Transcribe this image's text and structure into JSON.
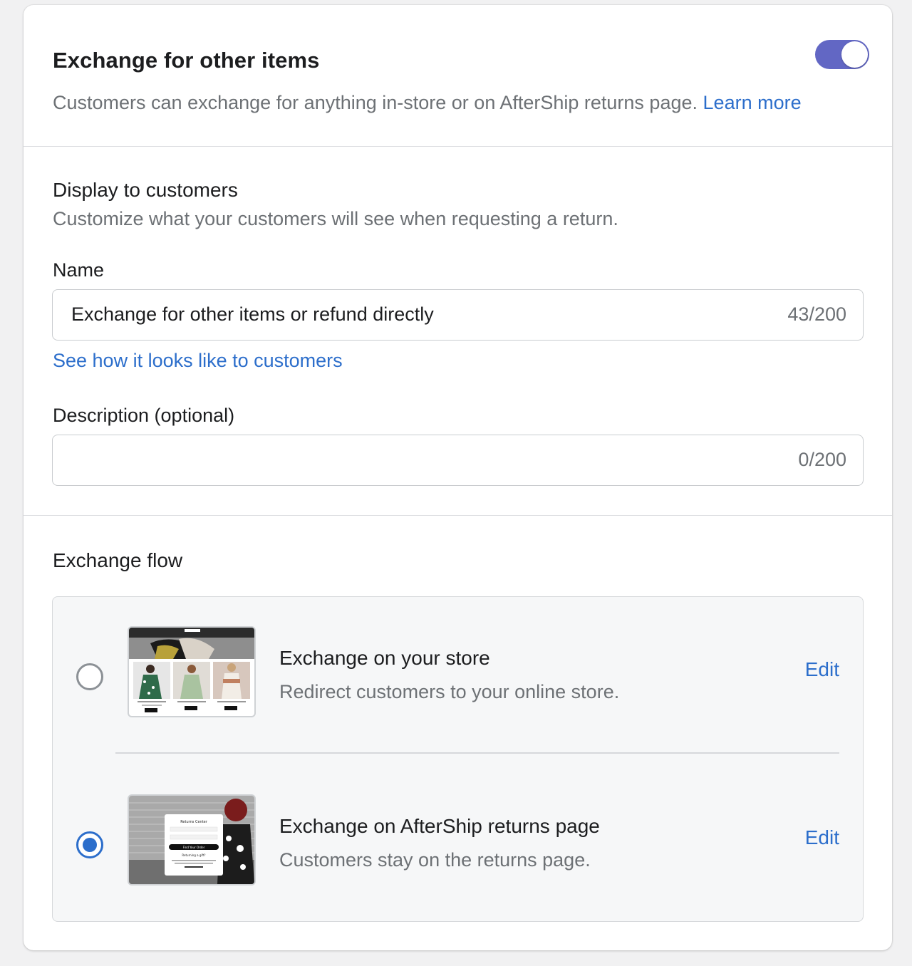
{
  "header": {
    "title": "Exchange for other items",
    "description": "Customers can exchange for anything in-store or on AfterShip returns page.",
    "learn_more": "Learn more",
    "toggle_on": true
  },
  "display": {
    "heading": "Display to customers",
    "subheading": "Customize what your customers will see when requesting a return.",
    "name_label": "Name",
    "name_value": "Exchange for other items or refund directly",
    "name_count": "43/200",
    "preview_link": "See how it looks like to customers",
    "description_label": "Description (optional)",
    "description_value": "",
    "description_count": "0/200"
  },
  "flow": {
    "heading": "Exchange flow",
    "options": [
      {
        "title": "Exchange on your store",
        "description": "Redirect customers to your online store.",
        "edit": "Edit",
        "selected": false
      },
      {
        "title": "Exchange on AfterShip returns page",
        "description": "Customers stay on the returns page.",
        "edit": "Edit",
        "selected": true
      }
    ]
  },
  "thumbnail_returns": {
    "title": "Returns Center",
    "button": "Find Your Order",
    "gift_text": "Returning a gift?"
  },
  "colors": {
    "accent": "#2c6ecb",
    "toggle": "#6267c4"
  }
}
